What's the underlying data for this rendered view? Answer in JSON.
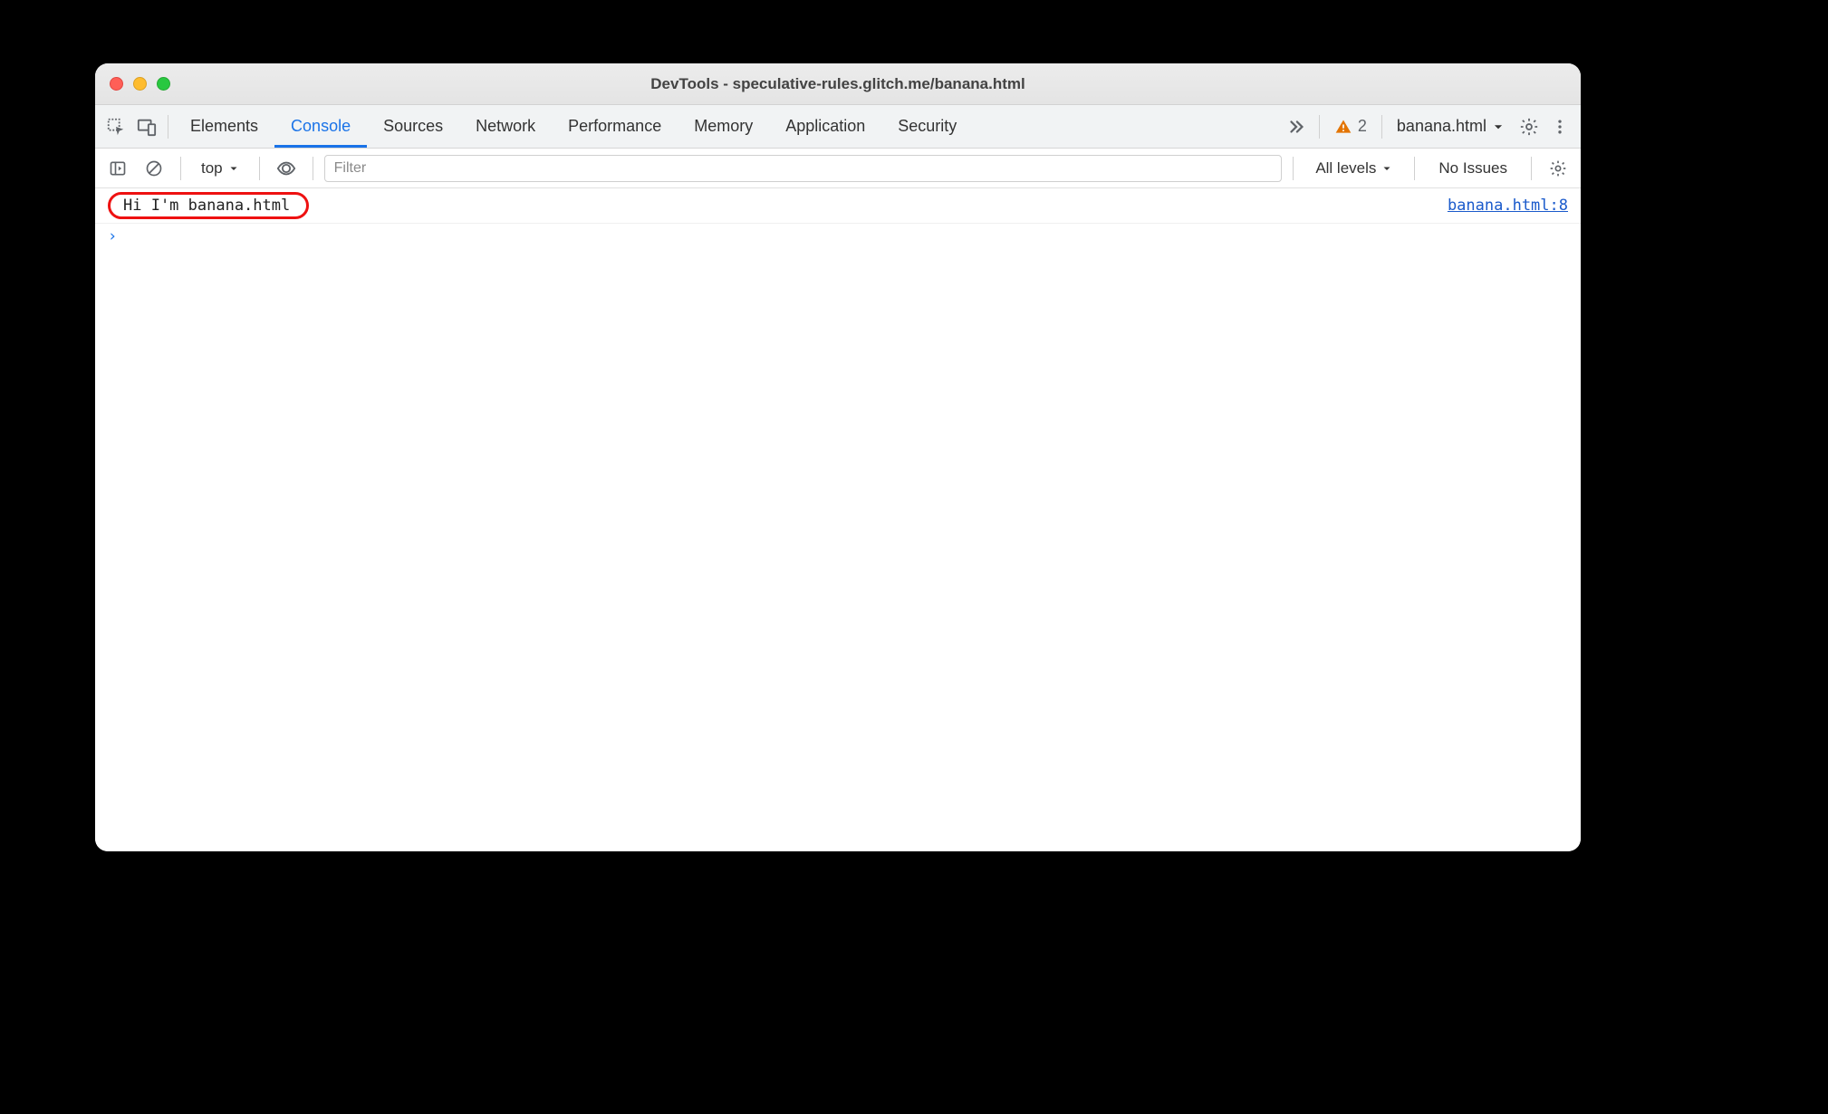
{
  "window": {
    "title": "DevTools - speculative-rules.glitch.me/banana.html"
  },
  "tabs": {
    "items": [
      "Elements",
      "Console",
      "Sources",
      "Network",
      "Performance",
      "Memory",
      "Application",
      "Security"
    ],
    "active_index": 1
  },
  "status": {
    "warning_count": "2",
    "page_selector": "banana.html"
  },
  "filter": {
    "context": "top",
    "placeholder": "Filter",
    "levels_label": "All levels",
    "issues_label": "No Issues"
  },
  "console": {
    "log_message": "Hi I'm banana.html",
    "log_source": "banana.html:8",
    "prompt": "›"
  }
}
